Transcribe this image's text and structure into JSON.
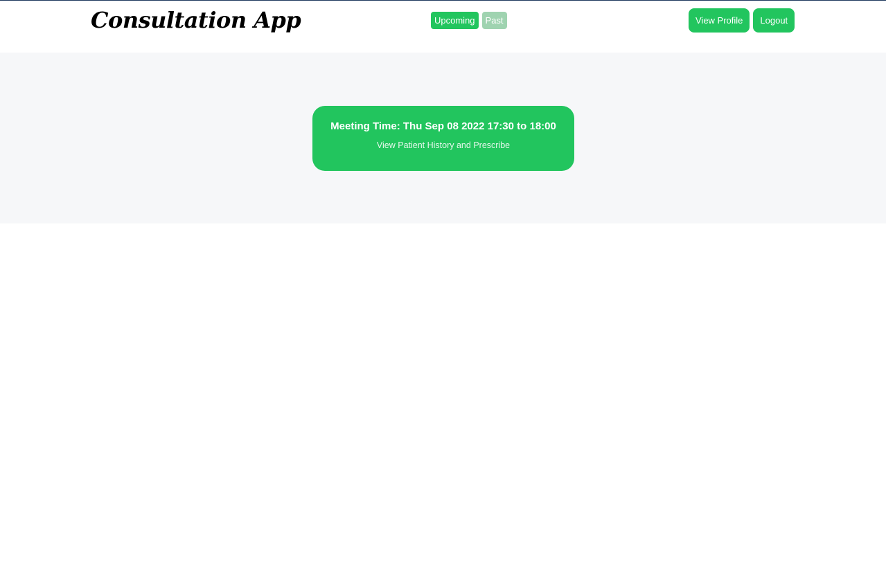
{
  "header": {
    "brand": "Consultation App",
    "tabs": [
      {
        "label": "Upcoming",
        "state": "active"
      },
      {
        "label": "Past",
        "state": "inactive"
      }
    ],
    "actions": {
      "view_profile_label": "View Profile",
      "logout_label": "Logout"
    }
  },
  "main": {
    "meeting": {
      "title": "Meeting Time: Thu Sep 08 2022 17:30 to 18:00",
      "link_label": "View Patient History and Prescribe"
    }
  },
  "colors": {
    "accent": "#22c55e",
    "accent_muted": "#9fd3b0",
    "content_bg": "#f6f7f9",
    "top_line": "#1f3a5f"
  }
}
